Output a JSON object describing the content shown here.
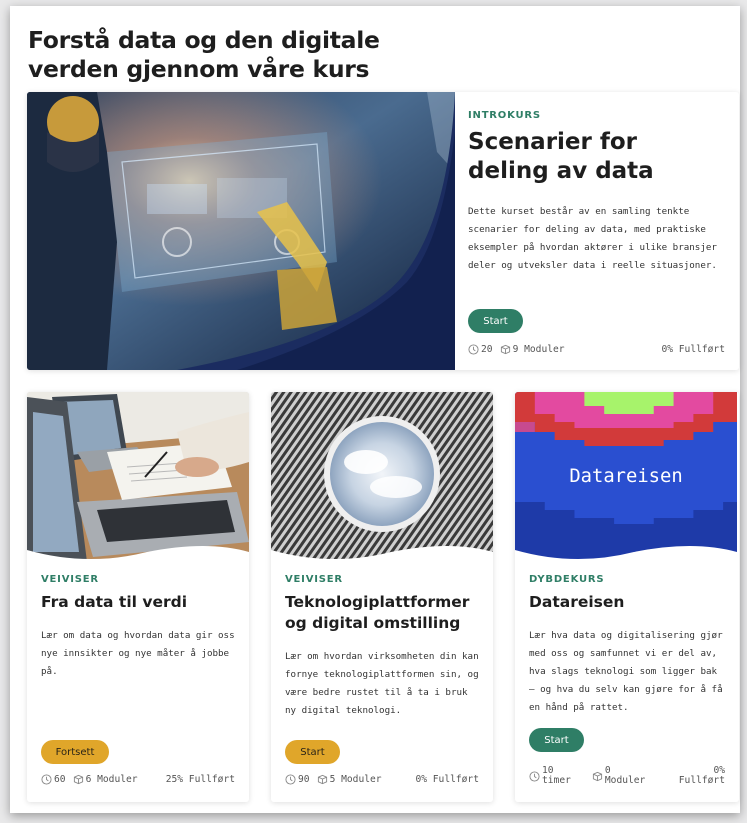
{
  "page": {
    "heading": "Forstå data og den digitale verden gjennom våre kurs"
  },
  "courses": [
    {
      "category": "INTROKURS",
      "title": "Scenarier for deling av data",
      "description": "Dette kurset består av en samling tenkte scenarier for deling av data, med praktiske eksempler på hvordan aktører i ulike bransjer deler og utveksler data i reelle situasjoner.",
      "button": "Start",
      "duration": "20",
      "modules": "9 Moduler",
      "progress": "0% Fullført"
    },
    {
      "category": "VEIVISER",
      "title": "Fra data til verdi",
      "description": "Lær om data og hvordan data gir oss nye innsikter og nye måter å jobbe på.",
      "button": "Fortsett",
      "duration": "60",
      "modules": "6 Moduler",
      "progress": "25% Fullført"
    },
    {
      "category": "VEIVISER",
      "title": "Teknologiplattformer og digital omstilling",
      "description": "Lær om hvordan virksomheten din kan fornye teknologiplattformen sin, og være bedre rustet til å ta i bruk ny digital teknologi.",
      "button": "Start",
      "duration": "90",
      "modules": "5 Moduler",
      "progress": "0% Fullført"
    },
    {
      "category": "DYBDEKURS",
      "title": "Datareisen",
      "image_text": "Datareisen",
      "description": "Lær hva data og digitalisering gjør med oss og samfunnet vi er del av, hva slags teknologi som ligger bak – og hva du selv kan gjøre for å få en hånd på rattet.",
      "button": "Start",
      "duration_value": "10",
      "duration_unit": "timer",
      "modules_value": "0",
      "modules_unit": "Moduler",
      "progress_value": "0%",
      "progress_unit": "Fullført"
    }
  ],
  "colors": {
    "accent_green": "#2f7e66",
    "accent_yellow": "#e0a62a"
  },
  "icons": {
    "duration": "clock-icon",
    "modules": "box-icon"
  }
}
